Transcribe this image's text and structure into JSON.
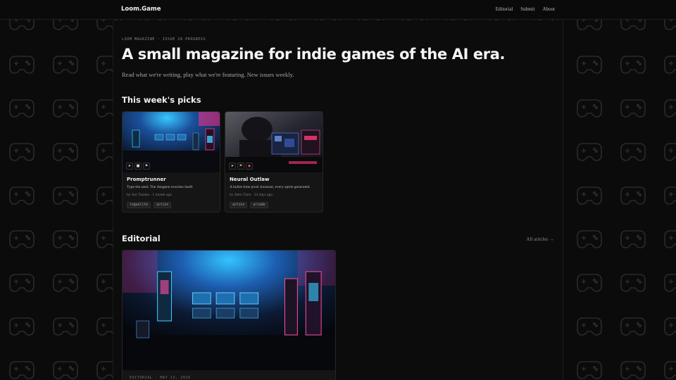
{
  "header": {
    "brand": "Loom.Game",
    "nav": [
      "Editorial",
      "Submit",
      "About"
    ]
  },
  "hero": {
    "kicker": "LOOM MAGAZINE · ISSUE 28 PROGRESS",
    "title": "A small magazine for indie games of the AI era.",
    "subtitle": "Read what we're writing, play what we're featuring. New issues weekly."
  },
  "picks": {
    "title": "This week's picks",
    "cards": [
      {
        "title": "Promptrunner",
        "description": "Type the seed. The dungeon rewrites itself.",
        "meta": "by Aoi Tanaka · 1 month ago",
        "tags": [
          "roguelite",
          "action"
        ],
        "chip_icons": [
          "cursor-icon",
          "square-icon",
          "flag-icon"
        ]
      },
      {
        "title": "Neural Outlaw",
        "description": "A bullet-time pixel shootout, every sprite generated.",
        "meta": "by Alex Chen · 24 days ago",
        "tags": [
          "action",
          "arcade"
        ],
        "chip_icons": [
          "cursor-icon",
          "flag-icon",
          "diamond-icon"
        ]
      }
    ]
  },
  "editorial": {
    "title": "Editorial",
    "all_link": "All articles →",
    "caption": "EDITORIAL · MAY 13, 2026"
  },
  "colors": {
    "background": "#0b0b0b",
    "panel": "#151515",
    "accent_cyan": "#22c6ff",
    "accent_magenta": "#ff2f8e"
  }
}
